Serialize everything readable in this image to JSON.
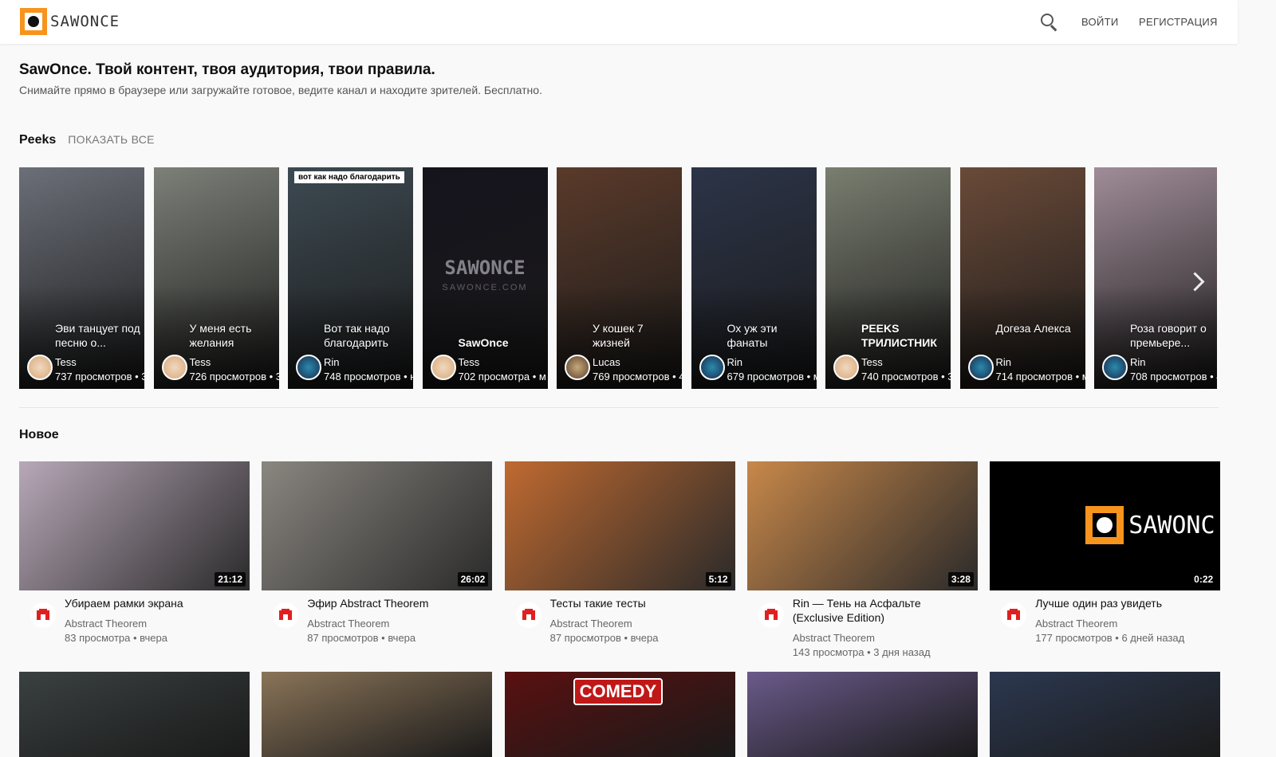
{
  "header": {
    "logo_text": "SAWONCE",
    "login": "ВОЙТИ",
    "register": "РЕГИСТРАЦИЯ"
  },
  "intro": {
    "title": "SawOnce. Твой контент, твоя аудитория, твои правила.",
    "subtitle": "Снимайте прямо в браузере или загружайте готовое, ведите канал и находите зрителей. Бесплатно."
  },
  "peeks": {
    "title": "Peeks",
    "show_all": "ПОКАЗАТЬ ВСЕ",
    "items": [
      {
        "title": "Эви танцует под песню о...",
        "author": "Tess",
        "meta": "737 просмотров • 3",
        "bg": "#6b6f78"
      },
      {
        "title": "У меня есть желания",
        "author": "Tess",
        "meta": "726 просмотров • 3",
        "bg": "#7c8078"
      },
      {
        "title": "Вот так надо благодарить",
        "author": "Rin",
        "meta": "748 просмотров • н",
        "tag": "вот как надо благодарить",
        "bg": "#3d4a52"
      },
      {
        "title": "SawOnce",
        "author": "Tess",
        "meta": "702 просмотра • м",
        "watermark": "SAWONCE",
        "watermark_sub": "SAWONCE.COM",
        "bg": "#15131c"
      },
      {
        "title": "У кошек 7 жизней",
        "author": "Lucas",
        "meta": "769 просмотров • 4",
        "bg": "#5a3a2a"
      },
      {
        "title": "Ох уж эти фанаты",
        "author": "Rin",
        "meta": "679 просмотров • м",
        "bg": "#2c3448"
      },
      {
        "title": "PEEKS ТРИЛИСТНИК",
        "author": "Tess",
        "meta": "740 просмотров • 3",
        "bg": "#7a7e70"
      },
      {
        "title": "Догеза Алекса",
        "author": "Rin",
        "meta": "714 просмотров • м",
        "bg": "#6a4a38"
      },
      {
        "title": "Роза говорит о премьере...",
        "author": "Rin",
        "meta": "708 просмотров • 4",
        "bg": "#a08c98"
      }
    ]
  },
  "new_section": {
    "title": "Новое",
    "videos": [
      {
        "title": "Убираем рамки экрана",
        "channel": "Abstract Theorem",
        "meta": "83 просмотра • вчера",
        "duration": "21:12",
        "bg": "#b8a8b8"
      },
      {
        "title": "Эфир Abstract Theorem",
        "channel": "Abstract Theorem",
        "meta": "87 просмотров • вчера",
        "duration": "26:02",
        "bg": "#8a8680"
      },
      {
        "title": "Тесты такие тесты",
        "channel": "Abstract Theorem",
        "meta": "87 просмотров • вчера",
        "duration": "5:12",
        "bg": "#c06a30"
      },
      {
        "title": "Rin — Тень на Асфальте (Exclusive Edition)",
        "channel": "Abstract Theorem",
        "meta": "143 просмотра • 3 дня назад",
        "duration": "3:28",
        "bg": "#c8884a"
      },
      {
        "title": "Лучше один раз увидеть",
        "channel": "Abstract Theorem",
        "meta": "177 просмотров • 6 дней назад",
        "duration": "0:22",
        "bg": "#000000",
        "watermark": "SAWONC"
      }
    ],
    "row2": [
      {
        "bg": "#3a4040"
      },
      {
        "bg": "#8a7458"
      },
      {
        "bg": "#5a1010",
        "badge": "COMEDY"
      },
      {
        "bg": "#6a5a8a"
      },
      {
        "bg": "#2c3850"
      }
    ]
  },
  "colors": {
    "brand": "#f7941d",
    "channel_icon": "#e02020"
  }
}
